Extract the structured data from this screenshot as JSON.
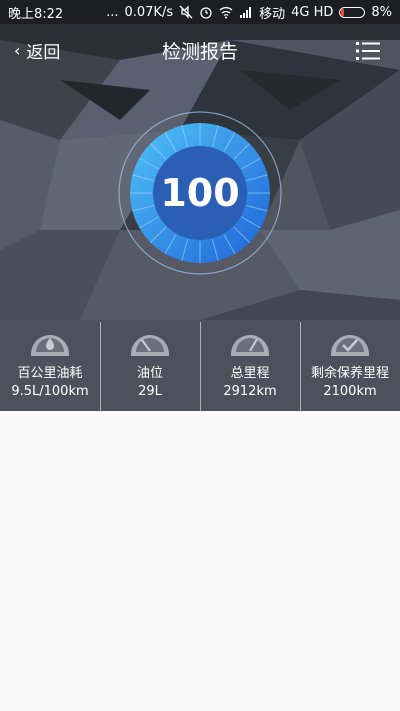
{
  "status_bar": {
    "time": "晚上8:22",
    "dots": "...",
    "speed": "0.07K/s",
    "carrier": "移动",
    "network": "4G HD",
    "battery": "8%"
  },
  "nav": {
    "back_label": "返回",
    "title": "检测报告"
  },
  "score": "100",
  "stats": [
    {
      "label": "百公里油耗",
      "value": "9.5L/100km",
      "icon": "fuel-consumption-icon"
    },
    {
      "label": "油位",
      "value": "29L",
      "icon": "fuel-gauge-icon"
    },
    {
      "label": "总里程",
      "value": "2912km",
      "icon": "odometer-icon"
    },
    {
      "label": "剩余保养里程",
      "value": "2100km",
      "icon": "maintenance-check-icon"
    }
  ],
  "colors": {
    "gauge_outer": "#2f7be8",
    "gauge_inner": "#1f5fbf",
    "gauge_ring": "#9fc4e8",
    "battery_low": "#ff4b3a"
  }
}
